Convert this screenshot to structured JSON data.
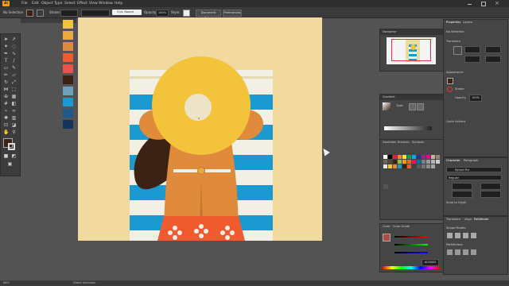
{
  "menubar": {
    "logo": "Ai",
    "items": [
      "File",
      "Edit",
      "Object",
      "Type",
      "Select",
      "Effect",
      "View",
      "Window",
      "Help"
    ]
  },
  "controlbar": {
    "selection": "No Selection",
    "stroke_label": "Stroke:",
    "brush_value": "3 pt. Round",
    "opacity_label": "Opacity:",
    "opacity_value": "100%",
    "style_label": "Style:",
    "document_setup": "Document Setup",
    "preferences": "Preferences"
  },
  "colors": {
    "accent": "#ff9a00",
    "ui_dark": "#2e2e2e",
    "ui_panel": "#454545",
    "artboard_bg": "#f1d9a0",
    "towel_blue": "#1a9ad0",
    "towel_white": "#f2efe4",
    "hat_yellow": "#f4c33c",
    "skin": "#e08a3c",
    "hair": "#3c2214",
    "shorts_red": "#f05a2f"
  },
  "swatch_column": [
    "#f4c33c",
    "#e9a93d",
    "#e08a3c",
    "#f05a2f",
    "#e8544a",
    "#3c2214",
    "#6f9fb9",
    "#1a9ad0",
    "#1f5a8a",
    "#16335b"
  ],
  "status": {
    "zoom": "66%",
    "tool": "Direct Selection"
  },
  "right_panels": {
    "properties_tab": "Properties",
    "layers_tab": "Layers",
    "no_selection": "No Selection",
    "transform": "Transform",
    "appearance": "Appearance",
    "stroke": "Stroke",
    "opacity": "Opacity",
    "opacity_value": "100%",
    "quick_actions": "Quick Actions",
    "character_tab": "Character",
    "paragraph_tab": "Paragraph",
    "font": "Myriad Pro",
    "font_style": "Regular",
    "snap_to_glyph": "Snap to Glyph",
    "transform_tab": "Transform",
    "align_tab": "Align",
    "pathfinder_tab": "Pathfinder",
    "shape_modes": "Shape Modes:",
    "pathfinders": "Pathfinders:"
  },
  "mid_panels": {
    "navigator": "Navigator",
    "gradient": "Gradient",
    "type_label": "Type:",
    "swatches_tab": "Swatches",
    "brushes_tab": "Brushes",
    "symbols_tab": "Symbols",
    "color_tab": "Color",
    "color_guide_tab": "Color Guide",
    "hex_value": "AC4D4D"
  },
  "swatch_grid": [
    "#ffffff",
    "#000000",
    "#ed1c24",
    "#ff8a00",
    "#fff200",
    "#00a651",
    "#00aeef",
    "#2e3192",
    "#92278f",
    "#ec008c",
    "#c7b299",
    "#998675",
    "#736357",
    "#534741",
    "#3c2415",
    "#8dc63f",
    "#f7941d",
    "#f26522",
    "#ed145b",
    "#0072bc",
    "#7f7f7f",
    "#999999",
    "#b3b3b3",
    "#cccccc",
    "#e6e6e6",
    "#f4c33c",
    "#e08a3c",
    "#1a9ad0",
    "#3c2214",
    "#f05a2f",
    "#404040",
    "#595959",
    "#737373",
    "#8c8c8c",
    "#a6a6a6"
  ]
}
